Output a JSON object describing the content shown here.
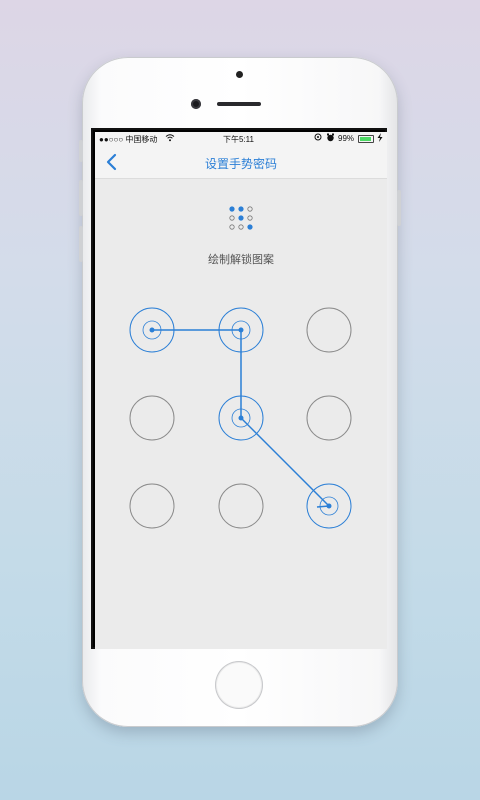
{
  "statusbar": {
    "carrier": "●●○○○ 中国移动",
    "wifi_icon": "wifi-icon",
    "time": "下午5:11",
    "battery_percent": "99%",
    "battery_level": 0.99
  },
  "navbar": {
    "back_icon": "chevron-left-icon",
    "title": "设置手势密码"
  },
  "preview": {
    "selected": [
      true,
      true,
      false,
      false,
      true,
      false,
      false,
      false,
      true
    ]
  },
  "hint": "绘制解锁图案",
  "pattern": {
    "selected_order": [
      0,
      1,
      4,
      8
    ],
    "accent_color": "#2b7fd6",
    "idle_color": "#8a8a8a"
  }
}
